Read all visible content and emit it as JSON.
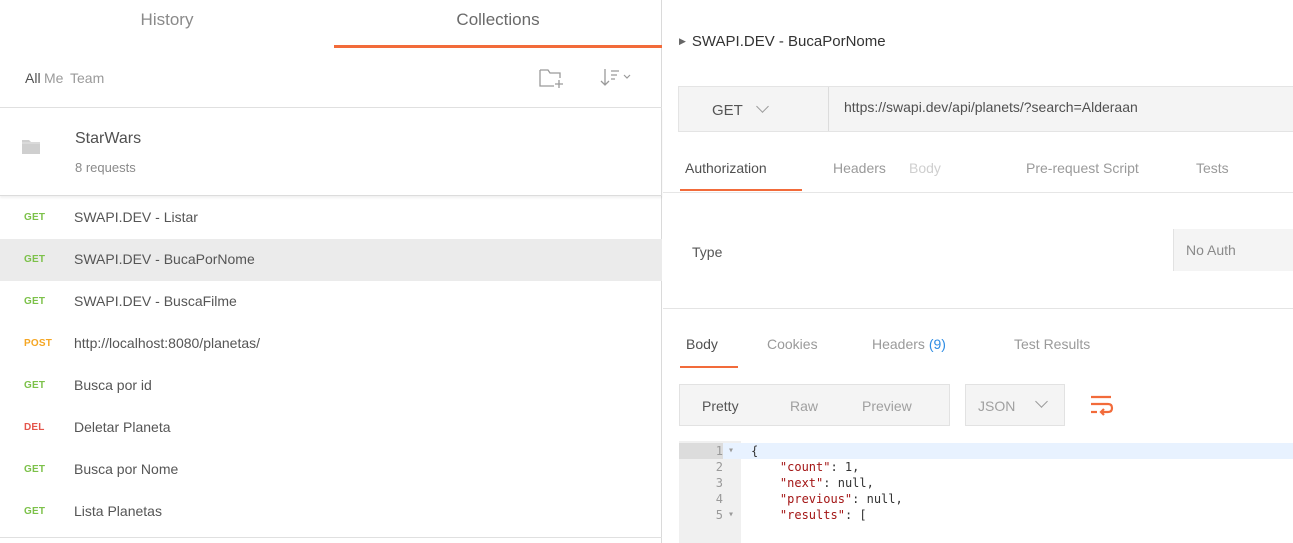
{
  "sidebar": {
    "tabs": {
      "history": "History",
      "collections": "Collections"
    },
    "filters": {
      "all": "All",
      "me": "Me",
      "team": "Team"
    },
    "collection": {
      "name": "StarWars",
      "count": "8 requests"
    },
    "requests": [
      {
        "method": "GET",
        "name": "SWAPI.DEV - Listar"
      },
      {
        "method": "GET",
        "name": "SWAPI.DEV - BucaPorNome"
      },
      {
        "method": "GET",
        "name": "SWAPI.DEV - BuscaFilme"
      },
      {
        "method": "POST",
        "name": "http://localhost:8080/planetas/"
      },
      {
        "method": "GET",
        "name": "Busca por id"
      },
      {
        "method": "DEL",
        "name": "Deletar Planeta"
      },
      {
        "method": "GET",
        "name": "Busca por Nome"
      },
      {
        "method": "GET",
        "name": "Lista Planetas"
      }
    ]
  },
  "request": {
    "title": "SWAPI.DEV - BucaPorNome",
    "method": "GET",
    "url": "https://swapi.dev/api/planets/?search=Alderaan",
    "tabs": {
      "authorization": "Authorization",
      "headers": "Headers",
      "body": "Body",
      "prerequest": "Pre-request Script",
      "tests": "Tests"
    },
    "auth": {
      "type_label": "Type",
      "type_value": "No Auth"
    }
  },
  "response": {
    "tabs": {
      "body": "Body",
      "cookies": "Cookies",
      "headers": "Headers",
      "headers_count": "(9)",
      "test_results": "Test Results"
    },
    "formats": {
      "pretty": "Pretty",
      "raw": "Raw",
      "preview": "Preview"
    },
    "language": "JSON",
    "lines": [
      {
        "n": "1",
        "fold": "▾",
        "key": "",
        "text": "{"
      },
      {
        "n": "2",
        "fold": "",
        "key": "\"count\"",
        "text": ": 1,"
      },
      {
        "n": "3",
        "fold": "",
        "key": "\"next\"",
        "text": ": null,"
      },
      {
        "n": "4",
        "fold": "",
        "key": "\"previous\"",
        "text": ": null,"
      },
      {
        "n": "5",
        "fold": "▾",
        "key": "\"results\"",
        "text": ": ["
      }
    ]
  },
  "colors": {
    "accent": "#f26b3a",
    "get": "#7cc149",
    "post": "#f5a623",
    "del": "#e4554b",
    "link": "#2f8de4"
  }
}
